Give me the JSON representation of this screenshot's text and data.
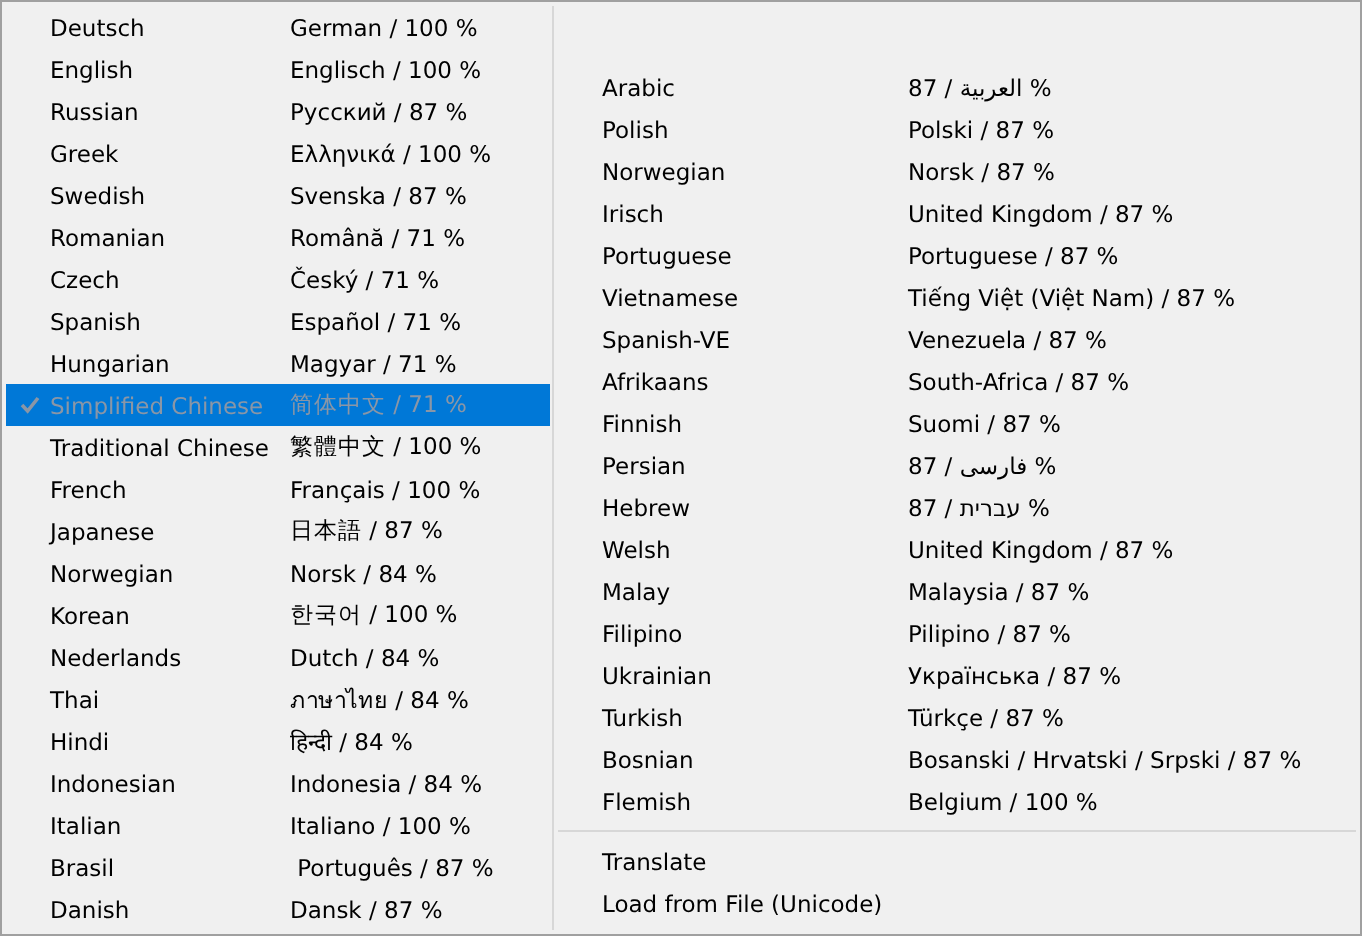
{
  "menu": {
    "left_items": [
      {
        "label": "Deutsch",
        "native": "German / 100 %",
        "selected": false
      },
      {
        "label": "English",
        "native": "Englisch / 100 %",
        "selected": false
      },
      {
        "label": "Russian",
        "native": "Русский / 87 %",
        "selected": false
      },
      {
        "label": "Greek",
        "native": "Ελληνικά / 100 %",
        "selected": false
      },
      {
        "label": "Swedish",
        "native": "Svenska / 87 %",
        "selected": false
      },
      {
        "label": "Romanian",
        "native": "Română / 71 %",
        "selected": false
      },
      {
        "label": "Czech",
        "native": "Český / 71 %",
        "selected": false
      },
      {
        "label": "Spanish",
        "native": "Español / 71 %",
        "selected": false
      },
      {
        "label": "Hungarian",
        "native": "Magyar / 71 %",
        "selected": false
      },
      {
        "label": "Simplified Chinese",
        "native": "简体中文 / 71 %",
        "selected": true
      },
      {
        "label": "Traditional Chinese",
        "native": "繁體中文 / 100 %",
        "selected": false
      },
      {
        "label": "French",
        "native": "Français / 100 %",
        "selected": false
      },
      {
        "label": "Japanese",
        "native": "日本語 / 87 %",
        "selected": false
      },
      {
        "label": "Norwegian",
        "native": "Norsk / 84 %",
        "selected": false
      },
      {
        "label": "Korean",
        "native": "한국어 / 100 %",
        "selected": false
      },
      {
        "label": "Nederlands",
        "native": "Dutch / 84 %",
        "selected": false
      },
      {
        "label": "Thai",
        "native": "ภาษาไทย / 84 %",
        "selected": false
      },
      {
        "label": "Hindi",
        "native": "हिन्दी / 84 %",
        "selected": false
      },
      {
        "label": "Indonesian",
        "native": "Indonesia / 84 %",
        "selected": false
      },
      {
        "label": "Italian",
        "native": "Italiano / 100 %",
        "selected": false
      },
      {
        "label": "Brasil",
        "native": " Português / 87 %",
        "selected": false
      },
      {
        "label": "Danish",
        "native": "Dansk / 87 %",
        "selected": false
      }
    ],
    "right_items": [
      {
        "label": "Arabic",
        "native": "العربية / 87 %",
        "selected": false
      },
      {
        "label": "Polish",
        "native": "Polski / 87 %",
        "selected": false
      },
      {
        "label": "Norwegian",
        "native": "Norsk / 87 %",
        "selected": false
      },
      {
        "label": "Irisch",
        "native": "United Kingdom / 87 %",
        "selected": false
      },
      {
        "label": "Portuguese",
        "native": "Portuguese / 87 %",
        "selected": false
      },
      {
        "label": "Vietnamese",
        "native": "Tiếng Việt (Việt Nam) / 87 %",
        "selected": false
      },
      {
        "label": "Spanish-VE",
        "native": "Venezuela / 87 %",
        "selected": false
      },
      {
        "label": "Afrikaans",
        "native": "South-Africa / 87 %",
        "selected": false
      },
      {
        "label": "Finnish",
        "native": "Suomi / 87 %",
        "selected": false
      },
      {
        "label": "Persian",
        "native": "فارسی / 87 %",
        "selected": false
      },
      {
        "label": "Hebrew",
        "native": "עברית / 87 %",
        "selected": false
      },
      {
        "label": "Welsh",
        "native": "United Kingdom / 87 %",
        "selected": false
      },
      {
        "label": "Malay",
        "native": "Malaysia / 87 %",
        "selected": false
      },
      {
        "label": "Filipino",
        "native": "Pilipino / 87 %",
        "selected": false
      },
      {
        "label": "Ukrainian",
        "native": "Українська / 87 %",
        "selected": false
      },
      {
        "label": "Turkish",
        "native": "Türkçe / 87 %",
        "selected": false
      },
      {
        "label": "Bosnian",
        "native": "Bosanski / Hrvatski / Srpski / 87 %",
        "selected": false
      },
      {
        "label": "Flemish",
        "native": "Belgium / 100 %",
        "selected": false
      }
    ],
    "commands": [
      {
        "label": "Translate"
      },
      {
        "label": "Load from File (Unicode)"
      }
    ]
  }
}
